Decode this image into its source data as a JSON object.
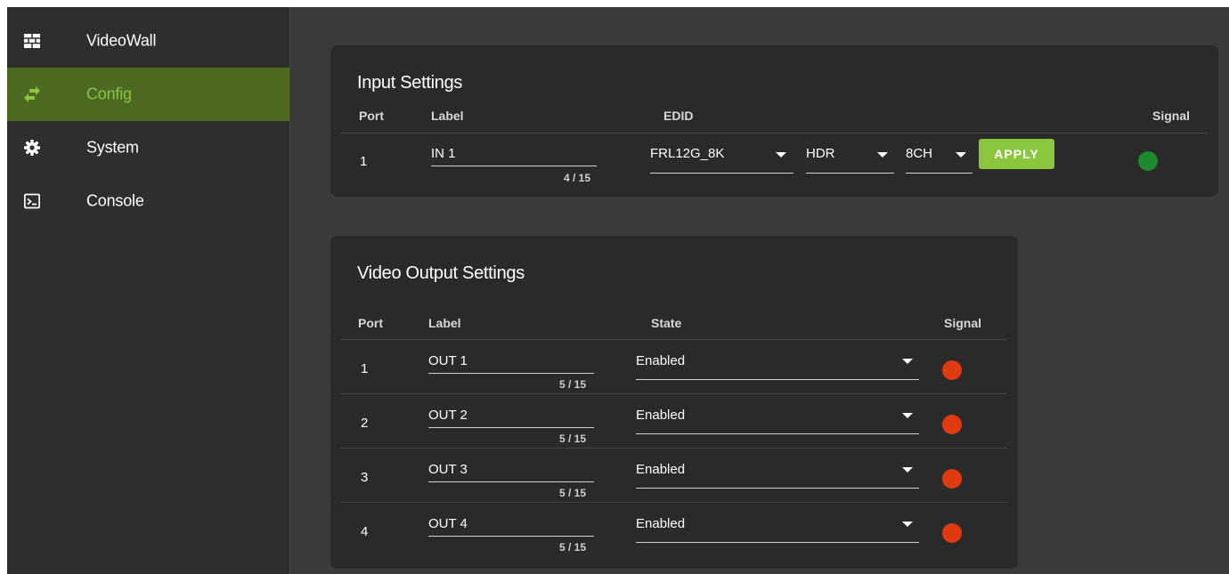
{
  "sidebar": {
    "items": [
      {
        "label": "VideoWall",
        "icon": "grid-icon"
      },
      {
        "label": "Config",
        "icon": "swap-arrows-icon",
        "active": true
      },
      {
        "label": "System",
        "icon": "gear-icon"
      },
      {
        "label": "Console",
        "icon": "terminal-icon"
      }
    ]
  },
  "input_settings": {
    "title": "Input Settings",
    "headers": {
      "port": "Port",
      "label": "Label",
      "edid": "EDID",
      "signal": "Signal"
    },
    "rows": [
      {
        "port": "1",
        "label": "IN 1",
        "counter": "4 / 15",
        "edid": "FRL12G_8K",
        "hdr": "HDR",
        "audio": "8CH",
        "apply": "APPLY",
        "signal_color": "#1e8a2e"
      }
    ]
  },
  "output_settings": {
    "title": "Video Output Settings",
    "headers": {
      "port": "Port",
      "label": "Label",
      "state": "State",
      "signal": "Signal"
    },
    "rows": [
      {
        "port": "1",
        "label": "OUT 1",
        "counter": "5 / 15",
        "state": "Enabled",
        "signal_color": "#e03a10"
      },
      {
        "port": "2",
        "label": "OUT 2",
        "counter": "5 / 15",
        "state": "Enabled",
        "signal_color": "#e03a10"
      },
      {
        "port": "3",
        "label": "OUT 3",
        "counter": "5 / 15",
        "state": "Enabled",
        "signal_color": "#e03a10"
      },
      {
        "port": "4",
        "label": "OUT 4",
        "counter": "5 / 15",
        "state": "Enabled",
        "signal_color": "#e03a10"
      }
    ]
  },
  "colors": {
    "accent": "#8bc63f",
    "active_nav_bg": "#4e6a22",
    "signal_ok": "#1e8a2e",
    "signal_off": "#e03a10"
  }
}
